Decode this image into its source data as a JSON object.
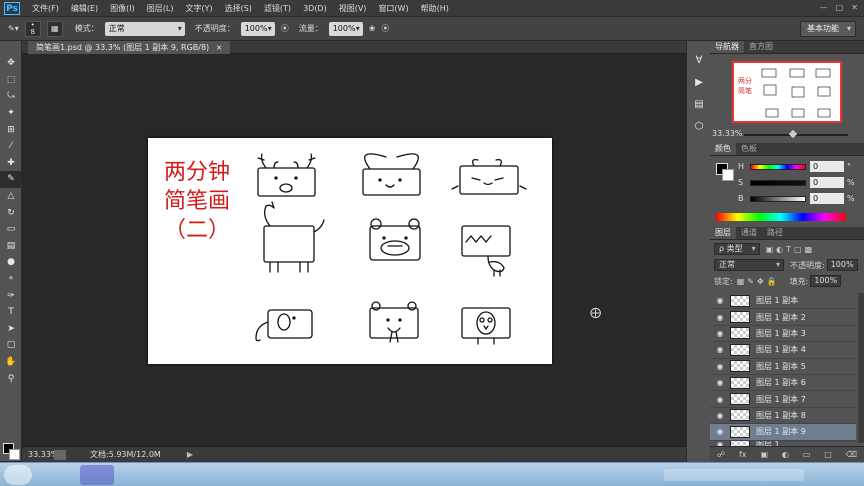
{
  "menubar": {
    "logo": "Ps",
    "items": [
      "文件(F)",
      "编辑(E)",
      "图像(I)",
      "图层(L)",
      "文字(Y)",
      "选择(S)",
      "滤镜(T)",
      "3D(D)",
      "视图(V)",
      "窗口(W)",
      "帮助(H)"
    ]
  },
  "options": {
    "brush_size": "8",
    "mode_label": "模式：",
    "mode_value": "正常",
    "opacity_label": "不透明度：",
    "opacity_value": "100%",
    "flow_label": "流量：",
    "flow_value": "100%",
    "workspace": "基本功能"
  },
  "document": {
    "tab_title": "简笔画1.psd @ 33.3% (图层 1 副本 9, RGB/8)",
    "tab_close": "×",
    "canvas_title_line1": "两分钟",
    "canvas_title_line2": "简笔画",
    "canvas_title_line3": "（二）"
  },
  "status": {
    "zoom": "33.33%",
    "doc_size": "文档:5.93M/12.0M",
    "arrow": "▶"
  },
  "navigator": {
    "tabs": [
      "导航器",
      "直方图"
    ],
    "zoom": "33.33%"
  },
  "color_panel": {
    "tabs": [
      "颜色",
      "色板"
    ],
    "h_label": "H",
    "h_value": "0",
    "h_unit": "°",
    "s_label": "S",
    "s_value": "0",
    "s_unit": "%",
    "b_label": "B",
    "b_value": "0",
    "b_unit": "%"
  },
  "layers_panel": {
    "tabs": [
      "图层",
      "通道",
      "路径"
    ],
    "filter_label": "ρ 类型",
    "blend_mode": "正常",
    "opacity_label": "不透明度:",
    "opacity_value": "100%",
    "lock_label": "锁定:",
    "fill_label": "填充:",
    "fill_value": "100%",
    "layers": [
      {
        "name": "图层 1 副本",
        "selected": false
      },
      {
        "name": "图层 1 副本 2",
        "selected": false
      },
      {
        "name": "图层 1 副本 3",
        "selected": false
      },
      {
        "name": "图层 1 副本 4",
        "selected": false
      },
      {
        "name": "图层 1 副本 5",
        "selected": false
      },
      {
        "name": "图层 1 副本 6",
        "selected": false
      },
      {
        "name": "图层 1 副本 7",
        "selected": false
      },
      {
        "name": "图层 1 副本 8",
        "selected": false
      },
      {
        "name": "图层 1 副本 9",
        "selected": true
      },
      {
        "name": "图层 1",
        "selected": false
      }
    ],
    "footer_icons": [
      "link-icon",
      "fx-icon",
      "mask-icon",
      "adjustment-icon",
      "folder-icon",
      "new-layer-icon",
      "trash-icon"
    ]
  },
  "tools": [
    "move-tool",
    "marquee-tool",
    "lasso-tool",
    "quick-select-tool",
    "crop-tool",
    "eyedropper-tool",
    "healing-tool",
    "brush-tool",
    "stamp-tool",
    "history-brush-tool",
    "eraser-tool",
    "gradient-tool",
    "blur-tool",
    "dodge-tool",
    "pen-tool",
    "type-tool",
    "path-select-tool",
    "shape-tool",
    "hand-tool",
    "zoom-tool"
  ]
}
